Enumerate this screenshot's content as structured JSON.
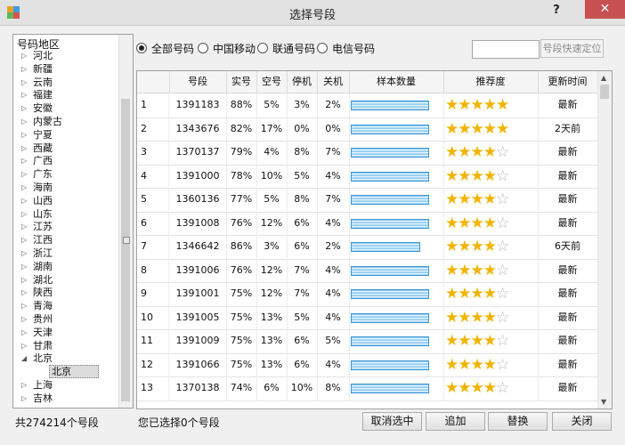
{
  "window": {
    "title": "选择号段",
    "help_label": "?",
    "close_label": "✕",
    "app_icon": "app-icon"
  },
  "tree": {
    "header": "号码地区",
    "items": [
      {
        "label": "河北",
        "expanded": false
      },
      {
        "label": "新疆",
        "expanded": false
      },
      {
        "label": "云南",
        "expanded": false
      },
      {
        "label": "福建",
        "expanded": false
      },
      {
        "label": "安徽",
        "expanded": false
      },
      {
        "label": "内蒙古",
        "expanded": false
      },
      {
        "label": "宁夏",
        "expanded": false
      },
      {
        "label": "西藏",
        "expanded": false
      },
      {
        "label": "广西",
        "expanded": false
      },
      {
        "label": "广东",
        "expanded": false
      },
      {
        "label": "海南",
        "expanded": false
      },
      {
        "label": "山西",
        "expanded": false
      },
      {
        "label": "山东",
        "expanded": false
      },
      {
        "label": "江苏",
        "expanded": false
      },
      {
        "label": "江西",
        "expanded": false
      },
      {
        "label": "浙江",
        "expanded": false
      },
      {
        "label": "湖南",
        "expanded": false
      },
      {
        "label": "湖北",
        "expanded": false
      },
      {
        "label": "陕西",
        "expanded": false
      },
      {
        "label": "青海",
        "expanded": false
      },
      {
        "label": "贵州",
        "expanded": false
      },
      {
        "label": "天津",
        "expanded": false
      },
      {
        "label": "甘肃",
        "expanded": false
      },
      {
        "label": "北京",
        "expanded": true
      },
      {
        "label": "北京",
        "child": true,
        "selected": true
      },
      {
        "label": "上海",
        "expanded": false
      },
      {
        "label": "吉林",
        "expanded": false
      }
    ]
  },
  "filters": {
    "options": [
      "全部号码",
      "中国移动",
      "联通号码",
      "电信号码"
    ],
    "selected": 0
  },
  "locate": {
    "input_value": "",
    "button_label": "号段快速定位"
  },
  "table": {
    "columns": [
      "",
      "号段",
      "实号",
      "空号",
      "停机",
      "关机",
      "样本数量",
      "推荐度",
      "更新时间"
    ],
    "rows": [
      {
        "idx": "1",
        "segment": "1391183",
        "real": "88%",
        "empty": "5%",
        "stopped": "3%",
        "off": "2%",
        "sample": 1.0,
        "stars": 5,
        "updated": "最新"
      },
      {
        "idx": "2",
        "segment": "1343676",
        "real": "82%",
        "empty": "17%",
        "stopped": "0%",
        "off": "0%",
        "sample": 1.0,
        "stars": 5,
        "updated": "2天前"
      },
      {
        "idx": "3",
        "segment": "1370137",
        "real": "79%",
        "empty": "4%",
        "stopped": "8%",
        "off": "7%",
        "sample": 1.0,
        "stars": 4,
        "updated": "最新"
      },
      {
        "idx": "4",
        "segment": "1391000",
        "real": "78%",
        "empty": "10%",
        "stopped": "5%",
        "off": "4%",
        "sample": 1.0,
        "stars": 4,
        "updated": "最新"
      },
      {
        "idx": "5",
        "segment": "1360136",
        "real": "77%",
        "empty": "5%",
        "stopped": "8%",
        "off": "7%",
        "sample": 1.0,
        "stars": 4,
        "updated": "最新"
      },
      {
        "idx": "6",
        "segment": "1391008",
        "real": "76%",
        "empty": "12%",
        "stopped": "6%",
        "off": "4%",
        "sample": 1.0,
        "stars": 4,
        "updated": "最新"
      },
      {
        "idx": "7",
        "segment": "1346642",
        "real": "86%",
        "empty": "3%",
        "stopped": "6%",
        "off": "2%",
        "sample": 0.89,
        "stars": 4,
        "updated": "6天前"
      },
      {
        "idx": "8",
        "segment": "1391006",
        "real": "76%",
        "empty": "12%",
        "stopped": "7%",
        "off": "4%",
        "sample": 1.0,
        "stars": 4,
        "updated": "最新"
      },
      {
        "idx": "9",
        "segment": "1391001",
        "real": "75%",
        "empty": "12%",
        "stopped": "7%",
        "off": "4%",
        "sample": 1.0,
        "stars": 4,
        "updated": "最新"
      },
      {
        "idx": "10",
        "segment": "1391005",
        "real": "75%",
        "empty": "13%",
        "stopped": "5%",
        "off": "4%",
        "sample": 1.0,
        "stars": 4,
        "updated": "最新"
      },
      {
        "idx": "11",
        "segment": "1391009",
        "real": "75%",
        "empty": "13%",
        "stopped": "6%",
        "off": "5%",
        "sample": 1.0,
        "stars": 4,
        "updated": "最新"
      },
      {
        "idx": "12",
        "segment": "1391066",
        "real": "75%",
        "empty": "13%",
        "stopped": "6%",
        "off": "4%",
        "sample": 1.0,
        "stars": 4,
        "updated": "最新"
      },
      {
        "idx": "13",
        "segment": "1370138",
        "real": "74%",
        "empty": "6%",
        "stopped": "10%",
        "off": "8%",
        "sample": 1.0,
        "stars": 4,
        "updated": "最新"
      }
    ]
  },
  "status": {
    "total": "共274214个号段",
    "selected": "您已选择0个号段"
  },
  "buttons": {
    "cancel_select": "取消选中",
    "add": "追加",
    "replace": "替换",
    "close": "关闭"
  },
  "colors": {
    "accent": "#3a95d4",
    "star": "#f0b400",
    "close": "#c75050"
  }
}
